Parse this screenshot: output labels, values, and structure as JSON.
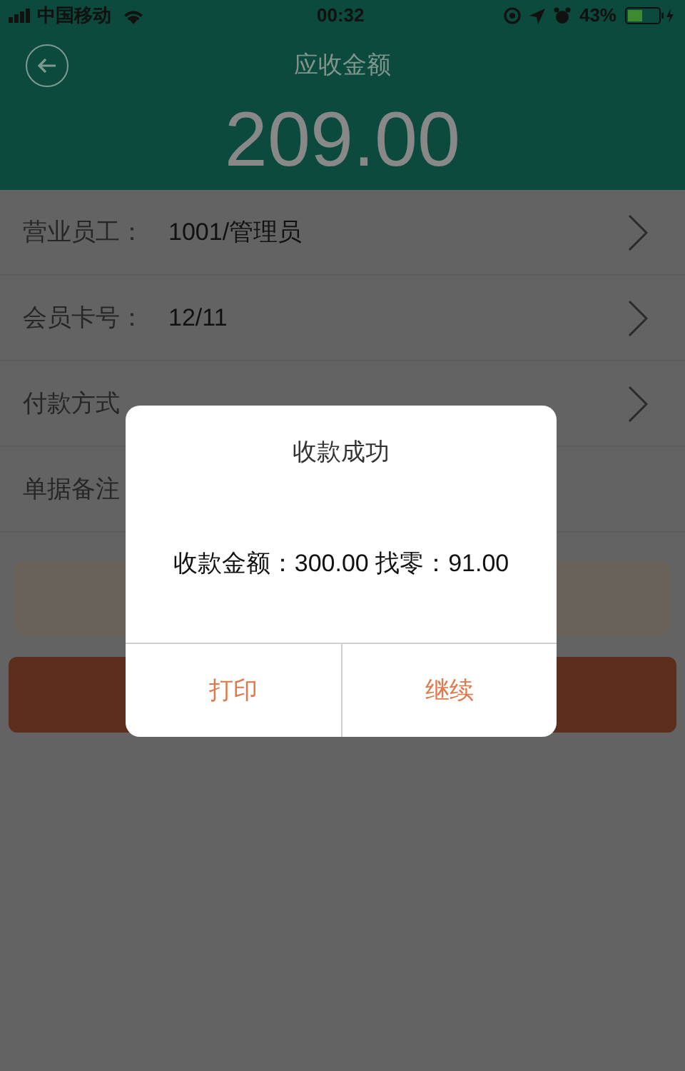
{
  "status_bar": {
    "carrier": "中国移动",
    "time": "00:32",
    "battery": "43%"
  },
  "header": {
    "title": "应收金额",
    "amount": "209.00"
  },
  "fields": [
    {
      "kind": "select",
      "label": "营业员工：",
      "value": "1001/管理员"
    },
    {
      "kind": "select",
      "label": "会员卡号：",
      "value": "12/11"
    },
    {
      "kind": "select",
      "label": "付款方式"
    },
    {
      "kind": "text",
      "label": "单据备注"
    }
  ],
  "action_buttons": [
    {
      "kind": "secondary"
    },
    {
      "kind": "primary"
    }
  ],
  "dialog": {
    "title": "收款成功",
    "message": "收款金额：300.00 找零：91.00",
    "buttons": [
      "打印",
      "继续"
    ]
  }
}
